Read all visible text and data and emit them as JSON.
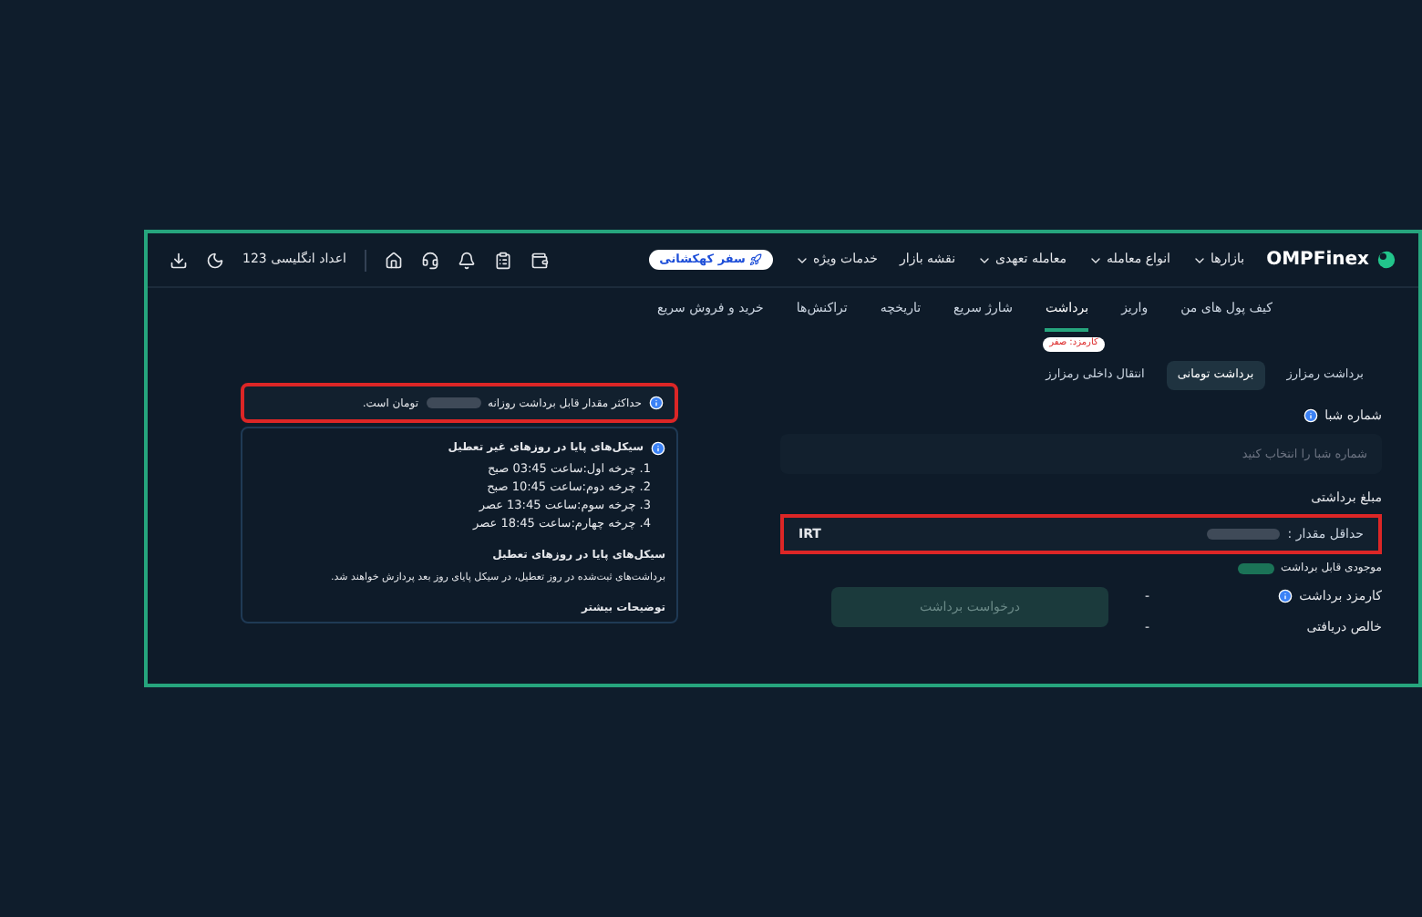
{
  "header": {
    "logo": "OMPFinex",
    "nav": [
      {
        "label": "بازارها",
        "dropdown": true
      },
      {
        "label": "انواع معامله",
        "dropdown": true
      },
      {
        "label": "معامله تعهدی",
        "dropdown": true
      },
      {
        "label": "نقشه بازار",
        "dropdown": false
      },
      {
        "label": "خدمات ویژه",
        "dropdown": true
      }
    ],
    "promo": "سفر کهکشانی",
    "digits_toggle": "اعداد انگلیسی 123"
  },
  "subnav": [
    {
      "label": "کیف پول های من",
      "selected": false
    },
    {
      "label": "واریز",
      "selected": false
    },
    {
      "label": "برداشت",
      "selected": true
    },
    {
      "label": "شارژ سریع",
      "selected": false
    },
    {
      "label": "تاریخچه",
      "selected": false
    },
    {
      "label": "تراکنش‌ها",
      "selected": false
    },
    {
      "label": "خرید و فروش سریع",
      "selected": false
    }
  ],
  "withdraw_tabs": [
    {
      "label": "برداشت رمزارز",
      "selected": false
    },
    {
      "label": "برداشت تومانی",
      "selected": true
    },
    {
      "label": "انتقال داخلی رمزارز",
      "selected": false,
      "badge": "کارمزد: صفر"
    }
  ],
  "sheba": {
    "label": "شماره شبا",
    "placeholder": "شماره شبا را انتخاب کنید"
  },
  "amount": {
    "label": "مبلغ برداشتی",
    "min_label": "حداقل مقدار :",
    "currency": "IRT",
    "highlighted": true
  },
  "balance_label": "موجودی قابل برداشت",
  "fee": {
    "label": "کارمزد برداشت",
    "value": "-"
  },
  "net": {
    "label": "خالص دریافتی",
    "value": "-"
  },
  "submit": {
    "label": "درخواست برداشت",
    "disabled": true
  },
  "notice": {
    "before": "حداکثر مقدار قابل برداشت روزانه",
    "after": "تومان است.",
    "highlighted": true
  },
  "cycles": {
    "title": "سیکل‌های پایا در روزهای غیر تعطیل",
    "items": [
      {
        "number": "1.",
        "text": "چرخه اول:ساعت 03:45 صبح"
      },
      {
        "number": "2.",
        "text": "چرخه دوم:ساعت 10:45 صبح"
      },
      {
        "number": "3.",
        "text": "چرخه سوم:ساعت 13:45 عصر"
      },
      {
        "number": "4.",
        "text": "چرخه چهارم:ساعت 18:45 عصر"
      }
    ],
    "holiday_title": "سیکل‌های پایا در روزهای تعطیل",
    "holiday_text": "برداشت‌های ثبت‌شده در روز تعطیل، در سیکل پایای روز بعد پردازش خواهند شد.",
    "more": "توضیحات بیشتر"
  }
}
